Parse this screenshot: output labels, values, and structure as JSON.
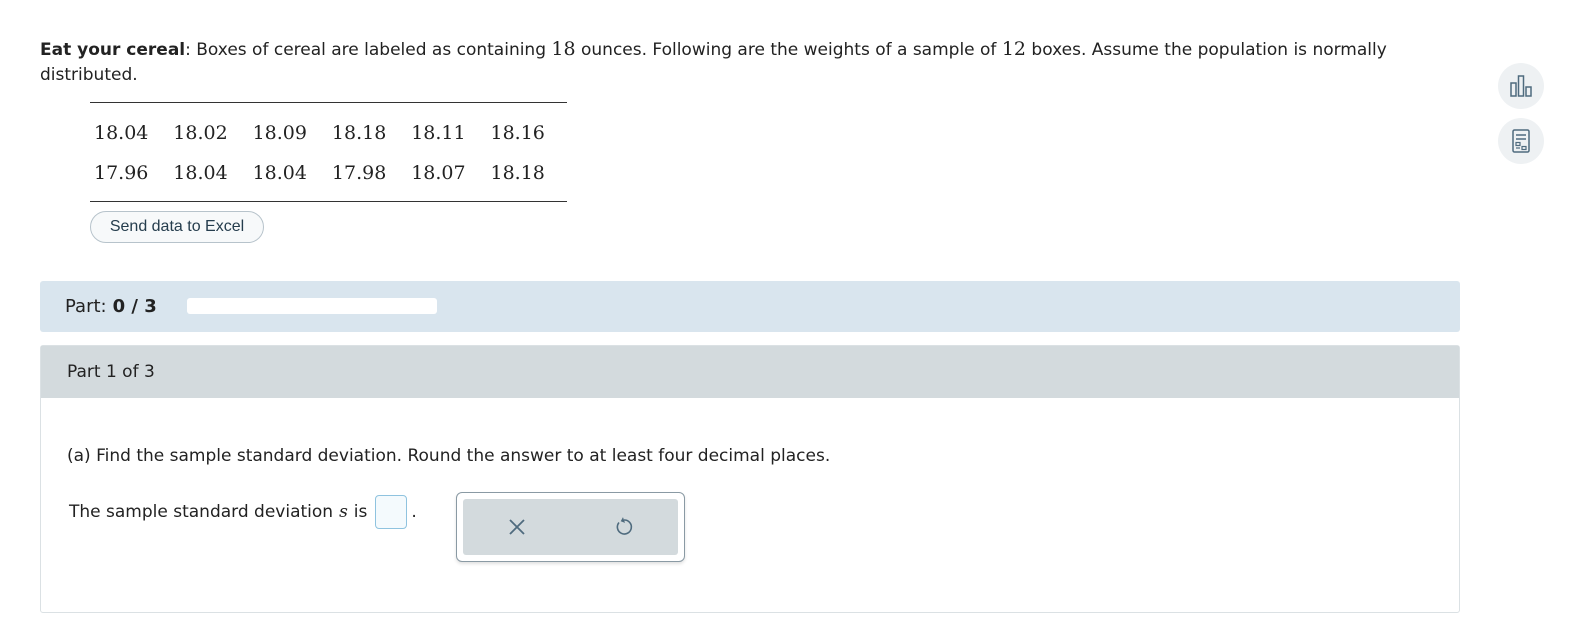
{
  "problem": {
    "title": "Eat your cereal",
    "text_1": ": Boxes of cereal are labeled as containing ",
    "ounces": "18",
    "text_2": " ounces. Following are the weights of a sample of ",
    "sample_size": "12",
    "text_3": " boxes. Assume the population is normally distributed."
  },
  "data_table": {
    "rows": [
      [
        "18.04",
        "18.02",
        "18.09",
        "18.18",
        "18.11",
        "18.16"
      ],
      [
        "17.96",
        "18.04",
        "18.04",
        "17.98",
        "18.07",
        "18.18"
      ]
    ]
  },
  "excel_button": "Send data to Excel",
  "part_bar": {
    "label": "Part:",
    "count": "0 / 3",
    "progress": 0
  },
  "part_panel": {
    "header": "Part 1 of 3",
    "question": "(a) Find the sample standard deviation. Round the answer to at least four decimal places.",
    "answer_prefix": "The sample standard deviation",
    "answer_var": "s",
    "answer_suffix": "is",
    "period": "."
  },
  "tools": {
    "clear": "x-icon",
    "undo": "undo-icon"
  },
  "side_tools": [
    "bar-chart-icon",
    "calculator-icon"
  ],
  "colors": {
    "part_bar_bg": "#d9e5ee",
    "part_header_bg": "#d3dadd",
    "input_border": "#8fc3df",
    "icon": "#4f6b7e"
  }
}
